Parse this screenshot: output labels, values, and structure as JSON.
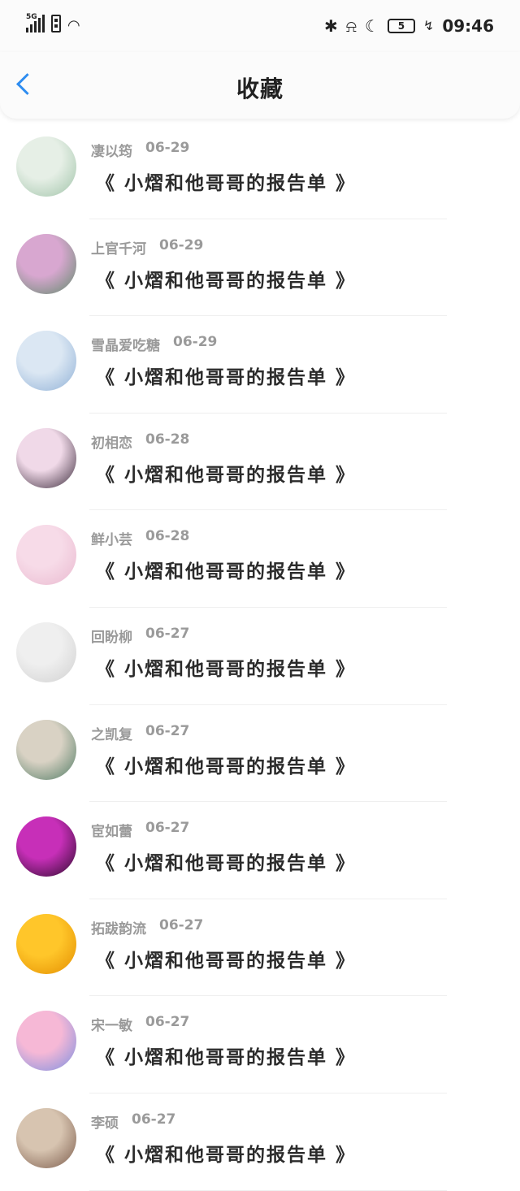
{
  "status": {
    "signal_label": "5G",
    "battery": "5",
    "time": "09:46"
  },
  "nav": {
    "title": "收藏"
  },
  "posts": [
    {
      "author": "凄以筠",
      "date": "06-29",
      "title": "《 小熠和他哥哥的报告单 》",
      "avatar_colors": [
        "#e6efe6",
        "#9fc3a8"
      ]
    },
    {
      "author": "上官千河",
      "date": "06-29",
      "title": "《 小熠和他哥哥的报告单 》",
      "avatar_colors": [
        "#d8a7d0",
        "#5f8a6a"
      ]
    },
    {
      "author": "雪晶爱吃糖",
      "date": "06-29",
      "title": "《 小熠和他哥哥的报告单 》",
      "avatar_colors": [
        "#dbe7f3",
        "#8fb0d6"
      ]
    },
    {
      "author": "初相恋",
      "date": "06-28",
      "title": "《 小熠和他哥哥的报告单 》",
      "avatar_colors": [
        "#f0d9e8",
        "#3a2a3a"
      ]
    },
    {
      "author": "鲜小芸",
      "date": "06-28",
      "title": "《 小熠和他哥哥的报告单 》",
      "avatar_colors": [
        "#f7dbe8",
        "#e9b9cf"
      ]
    },
    {
      "author": "回盼柳",
      "date": "06-27",
      "title": "《 小熠和他哥哥的报告单 》",
      "avatar_colors": [
        "#efefef",
        "#d0d0d0"
      ]
    },
    {
      "author": "之凯复",
      "date": "06-27",
      "title": "《 小熠和他哥哥的报告单 》",
      "avatar_colors": [
        "#d9d2c4",
        "#4f7a63"
      ]
    },
    {
      "author": "宦如蕾",
      "date": "06-27",
      "title": "《 小熠和他哥哥的报告单 》",
      "avatar_colors": [
        "#c72fb8",
        "#2a0a2a"
      ]
    },
    {
      "author": "拓跋韵流",
      "date": "06-27",
      "title": "《 小熠和他哥哥的报告单 》",
      "avatar_colors": [
        "#ffc62a",
        "#e38d00"
      ]
    },
    {
      "author": "宋一敏",
      "date": "06-27",
      "title": "《 小熠和他哥哥的报告单 》",
      "avatar_colors": [
        "#f6b8d6",
        "#7a8fe0"
      ]
    },
    {
      "author": "李硕",
      "date": "06-27",
      "title": "《 小熠和他哥哥的报告单 》",
      "avatar_colors": [
        "#d7c4b0",
        "#7a5a4a"
      ]
    }
  ]
}
